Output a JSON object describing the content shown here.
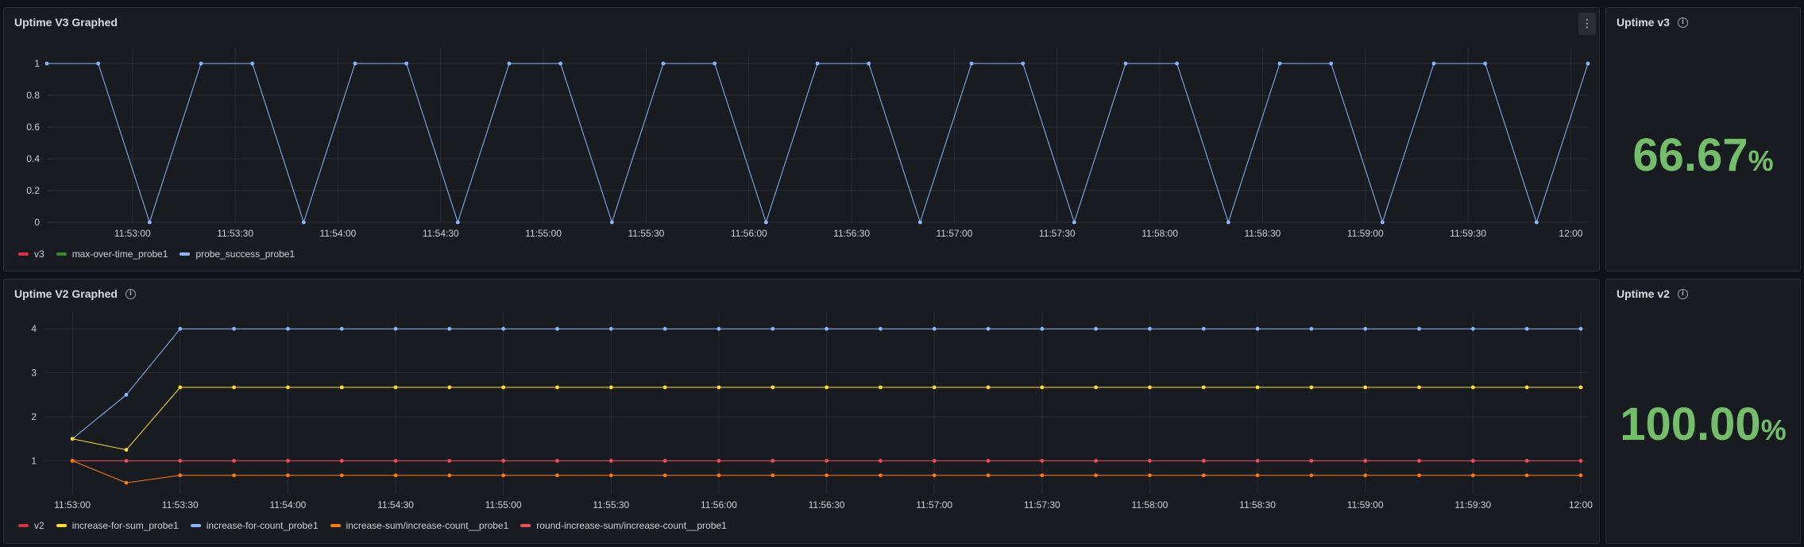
{
  "colors": {
    "red": "#e02f44",
    "green": "#37872d",
    "blue": "#8ab8ff",
    "yellow": "#fade2a",
    "orange": "#ff780a",
    "lightred": "#f2495c",
    "stat": "#73bf69"
  },
  "panels": {
    "v3_graph": {
      "title": "Uptime V3 Graphed",
      "menu_icon": "kebab-menu-icon",
      "legend": [
        {
          "name": "v3",
          "color": "#e02f44"
        },
        {
          "name": "max-over-time_probe1",
          "color": "#37872d"
        },
        {
          "name": "probe_success_probe1",
          "color": "#8ab8ff"
        }
      ]
    },
    "v3_stat": {
      "title": "Uptime v3",
      "info_icon": "info-icon",
      "value": "66.67",
      "unit": "%"
    },
    "v2_graph": {
      "title": "Uptime V2 Graphed",
      "info_icon": "info-icon",
      "legend": [
        {
          "name": "v2",
          "color": "#e02f44"
        },
        {
          "name": "increase-for-sum_probe1",
          "color": "#fade2a"
        },
        {
          "name": "increase-for-count_probe1",
          "color": "#8ab8ff"
        },
        {
          "name": "increase-sum/increase-count__probe1",
          "color": "#ff780a"
        },
        {
          "name": "round-increase-sum/increase-count__probe1",
          "color": "#f2495c"
        }
      ]
    },
    "v2_stat": {
      "title": "Uptime v2",
      "info_icon": "info-icon",
      "value": "100.00",
      "unit": "%"
    }
  },
  "chart_data": [
    {
      "type": "line",
      "title": "Uptime V3 Graphed",
      "x_unit": "time",
      "x_range": [
        "11:52:35",
        "12:00:05"
      ],
      "x_ticks": [
        "11:53:00",
        "11:53:30",
        "11:54:00",
        "11:54:30",
        "11:55:00",
        "11:55:30",
        "11:56:00",
        "11:56:30",
        "11:57:00",
        "11:57:30",
        "11:58:00",
        "11:58:30",
        "11:59:00",
        "11:59:30",
        "12:00:00"
      ],
      "x_tick_labels": [
        "11:53:00",
        "11:53:30",
        "11:54:00",
        "11:54:30",
        "11:55:00",
        "11:55:30",
        "11:56:00",
        "11:56:30",
        "11:57:00",
        "11:57:30",
        "11:58:00",
        "11:58:30",
        "11:59:00",
        "11:59:30",
        "12:00"
      ],
      "y_ticks": [
        0,
        0.2,
        0.4,
        0.6,
        0.8,
        1
      ],
      "y_tick_labels": [
        "0",
        "0.2",
        "0.4",
        "0.6",
        "0.8",
        "1"
      ],
      "ylim": [
        0,
        1.1
      ],
      "grid": true,
      "legend": "bottom-left",
      "x": [
        "11:52:35",
        "11:52:50",
        "11:53:05",
        "11:53:20",
        "11:53:35",
        "11:53:50",
        "11:54:05",
        "11:54:20",
        "11:54:35",
        "11:54:50",
        "11:55:05",
        "11:55:20",
        "11:55:35",
        "11:55:50",
        "11:56:05",
        "11:56:20",
        "11:56:35",
        "11:56:50",
        "11:57:05",
        "11:57:20",
        "11:57:35",
        "11:57:50",
        "11:58:05",
        "11:58:20",
        "11:58:35",
        "11:58:50",
        "11:59:05",
        "11:59:20",
        "11:59:35",
        "11:59:50",
        "12:00:05"
      ],
      "series": [
        {
          "name": "probe_success_probe1",
          "color": "#8ab8ff",
          "values": [
            1,
            1,
            0,
            1,
            1,
            0,
            1,
            1,
            0,
            1,
            1,
            0,
            1,
            1,
            0,
            1,
            1,
            0,
            1,
            1,
            0,
            1,
            1,
            0,
            1,
            1,
            0,
            1,
            1,
            0,
            1
          ]
        }
      ]
    },
    {
      "type": "line",
      "title": "Uptime V2 Graphed",
      "x_unit": "time",
      "x_range": [
        "11:52:52",
        "12:00:02"
      ],
      "x_ticks": [
        "11:53:00",
        "11:53:30",
        "11:54:00",
        "11:54:30",
        "11:55:00",
        "11:55:30",
        "11:56:00",
        "11:56:30",
        "11:57:00",
        "11:57:30",
        "11:58:00",
        "11:58:30",
        "11:59:00",
        "11:59:30",
        "12:00:00"
      ],
      "x_tick_labels": [
        "11:53:00",
        "11:53:30",
        "11:54:00",
        "11:54:30",
        "11:55:00",
        "11:55:30",
        "11:56:00",
        "11:56:30",
        "11:57:00",
        "11:57:30",
        "11:58:00",
        "11:58:30",
        "11:59:00",
        "11:59:30",
        "12:00"
      ],
      "y_ticks": [
        1,
        2,
        3,
        4
      ],
      "y_tick_labels": [
        "1",
        "2",
        "3",
        "4"
      ],
      "ylim": [
        0.25,
        4.4
      ],
      "grid": true,
      "legend": "bottom-left",
      "x": [
        "11:53:00",
        "11:53:15",
        "11:53:30",
        "11:53:45",
        "11:54:00",
        "11:54:15",
        "11:54:30",
        "11:54:45",
        "11:55:00",
        "11:55:15",
        "11:55:30",
        "11:55:45",
        "11:56:00",
        "11:56:15",
        "11:56:30",
        "11:56:45",
        "11:57:00",
        "11:57:15",
        "11:57:30",
        "11:57:45",
        "11:58:00",
        "11:58:15",
        "11:58:30",
        "11:58:45",
        "11:59:00",
        "11:59:15",
        "11:59:30",
        "11:59:45",
        "12:00:00"
      ],
      "series": [
        {
          "name": "increase-for-count_probe1",
          "color": "#8ab8ff",
          "values": [
            1.5,
            2.5,
            4,
            4,
            4,
            4,
            4,
            4,
            4,
            4,
            4,
            4,
            4,
            4,
            4,
            4,
            4,
            4,
            4,
            4,
            4,
            4,
            4,
            4,
            4,
            4,
            4,
            4,
            4
          ]
        },
        {
          "name": "increase-for-sum_probe1",
          "color": "#fade2a",
          "values": [
            1.5,
            1.25,
            2.67,
            2.67,
            2.67,
            2.67,
            2.67,
            2.67,
            2.67,
            2.67,
            2.67,
            2.67,
            2.67,
            2.67,
            2.67,
            2.67,
            2.67,
            2.67,
            2.67,
            2.67,
            2.67,
            2.67,
            2.67,
            2.67,
            2.67,
            2.67,
            2.67,
            2.67,
            2.67
          ]
        },
        {
          "name": "round-increase-sum/increase-count__probe1",
          "color": "#f2495c",
          "values": [
            1,
            1,
            1,
            1,
            1,
            1,
            1,
            1,
            1,
            1,
            1,
            1,
            1,
            1,
            1,
            1,
            1,
            1,
            1,
            1,
            1,
            1,
            1,
            1,
            1,
            1,
            1,
            1,
            1
          ]
        },
        {
          "name": "increase-sum/increase-count__probe1",
          "color": "#ff780a",
          "values": [
            1,
            0.5,
            0.67,
            0.67,
            0.67,
            0.67,
            0.67,
            0.67,
            0.67,
            0.67,
            0.67,
            0.67,
            0.67,
            0.67,
            0.67,
            0.67,
            0.67,
            0.67,
            0.67,
            0.67,
            0.67,
            0.67,
            0.67,
            0.67,
            0.67,
            0.67,
            0.67,
            0.67,
            0.67
          ]
        }
      ]
    }
  ]
}
